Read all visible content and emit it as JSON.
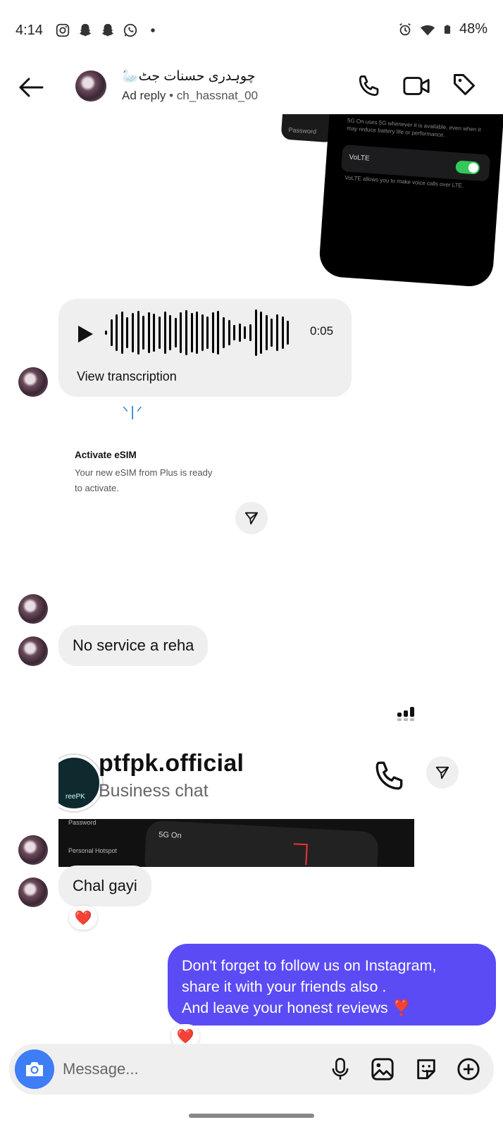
{
  "status_bar": {
    "time": "4:14",
    "left_icons": [
      "instagram-icon",
      "snapchat-icon",
      "snapchat-icon",
      "whatsapp-icon",
      "dot-icon"
    ],
    "right_icons": [
      "alarm-icon",
      "wifi-icon",
      "battery-icon"
    ],
    "battery": "48%"
  },
  "header": {
    "contact_name": "چوہدری حسنات جٹ🦢",
    "ad_label": "Ad reply",
    "separator": " • ",
    "username": "ch_hassnat_00",
    "icons": [
      "back-arrow-icon",
      "phone-icon",
      "video-camera-icon",
      "tag-icon"
    ]
  },
  "screenshot_top": {
    "row_label": "VoLTE",
    "row_desc": "VoLTE allows you to make voice calls over LTE.",
    "top_note": "5G On uses 5G whenever it is available, even when it may reduce battery life or performance.",
    "side_label": "Password"
  },
  "voice_message": {
    "duration": "0:05",
    "transcription_label": "View transcription"
  },
  "esim_card": {
    "signal_glyph": "ᐠ|ᐟ",
    "title": "Activate eSIM",
    "description": "Your new eSIM from Plus is ready to activate."
  },
  "messages": {
    "no_service": "No service a reha",
    "chal_gayi": "Chal gayi",
    "outgoing_line1": "Don't forget to follow us on Instagram,",
    "outgoing_line2": "share it with your friends also .",
    "outgoing_line3": "And leave your honest reviews ❣️"
  },
  "reactions": {
    "heart": "❤️"
  },
  "business_card": {
    "name": "ptfpk.official",
    "subtitle": "Business chat",
    "logo_text": "reePK",
    "dark_label": "5G On",
    "dark_side": "Password",
    "dark_side2": "Personal Hotspot"
  },
  "composer": {
    "placeholder": "Message...",
    "icons": [
      "camera-icon",
      "microphone-icon",
      "gallery-icon",
      "sticker-icon",
      "plus-circle-icon"
    ]
  },
  "colors": {
    "outgoing_bubble": "#5b4bf5",
    "incoming_bubble": "#efefef",
    "camera_button": "#3d7df5",
    "volte_toggle": "#34c759",
    "esim_signal": "#1f7ad6"
  }
}
